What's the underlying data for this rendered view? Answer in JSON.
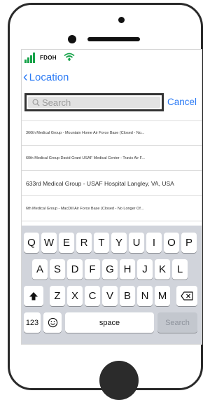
{
  "status_bar": {
    "carrier": "FDOH"
  },
  "nav": {
    "back_label": "Location"
  },
  "search": {
    "placeholder": "Search",
    "cancel_label": "Cancel"
  },
  "results": [
    {
      "text": "366th Medical Group - Mountain Home Air Force Base (Closed - No...",
      "size": "small"
    },
    {
      "text": "60th Medical Group David Grant USAF Medical Center - Travis Air F...",
      "size": "small"
    },
    {
      "text": "633rd Medical Group - USAF Hospital Langley, VA, USA",
      "size": "big"
    },
    {
      "text": "6th Medical Group - MacDill Air Force Base (Closed - No Longer Of...",
      "size": "small"
    }
  ],
  "keyboard": {
    "row1": [
      "Q",
      "W",
      "E",
      "R",
      "T",
      "Y",
      "U",
      "I",
      "O",
      "P"
    ],
    "row2": [
      "A",
      "S",
      "D",
      "F",
      "G",
      "H",
      "J",
      "K",
      "L"
    ],
    "row3": [
      "Z",
      "X",
      "C",
      "V",
      "B",
      "N",
      "M"
    ],
    "numbers_label": "123",
    "space_label": "space",
    "search_label": "Search",
    "shift_icon": "shift-icon",
    "delete_icon": "backspace-icon",
    "emoji_icon": "emoji-icon"
  },
  "colors": {
    "accent": "#2c7bf5",
    "signal": "#17a34a",
    "keyboard_bg": "#d1d4db"
  }
}
